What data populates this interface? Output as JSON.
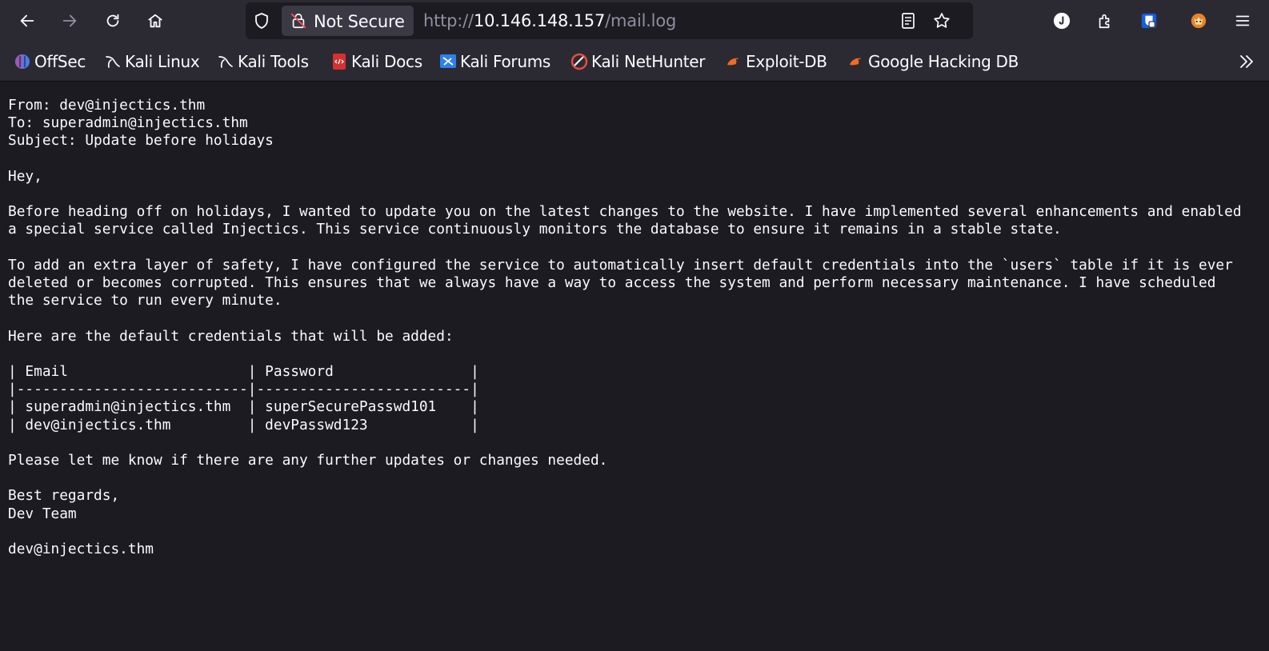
{
  "browser": {
    "security_label": "Not Secure",
    "url_scheme": "http://",
    "url_host": "10.146.148.157",
    "url_path": "/mail.log",
    "icons": [
      "back-icon",
      "forward-icon",
      "reload-icon",
      "home-icon",
      "shield-icon",
      "broken-lock-icon",
      "reader-view-icon",
      "bookmark-star-icon",
      "account-icon",
      "extensions-icon",
      "bitwarden-icon",
      "foxyproxy-icon",
      "menu-icon"
    ]
  },
  "bookmarks": [
    {
      "label": "OffSec",
      "icon": "offsec-icon"
    },
    {
      "label": "Kali Linux",
      "icon": "kali-dragon-icon"
    },
    {
      "label": "Kali Tools",
      "icon": "kali-dragon-icon"
    },
    {
      "label": "Kali Docs",
      "icon": "kali-docs-icon"
    },
    {
      "label": "Kali Forums",
      "icon": "kali-forums-icon"
    },
    {
      "label": "Kali NetHunter",
      "icon": "nethunter-icon"
    },
    {
      "label": "Exploit-DB",
      "icon": "exploitdb-icon"
    },
    {
      "label": "Google Hacking DB",
      "icon": "exploitdb-icon"
    }
  ],
  "colors": {
    "toolbar_bg": "#2b2a33",
    "content_bg": "#1c1b22",
    "text": "#fbfbfe"
  },
  "mail": {
    "from": "From: dev@injectics.thm",
    "to": "To: superadmin@injectics.thm",
    "subject": "Subject: Update before holidays",
    "greeting": "Hey,",
    "para1_line1": "Before heading off on holidays, I wanted to update you on the latest changes to the website. I have implemented several enhancements and enabled",
    "para1_line2": "a special service called Injectics. This service continuously monitors the database to ensure it remains in a stable state.",
    "para2_line1": "To add an extra layer of safety, I have configured the service to automatically insert default credentials into the `users` table if it is ever",
    "para2_line2": "deleted or becomes corrupted. This ensures that we always have a way to access the system and perform necessary maintenance. I have scheduled",
    "para2_line3": "the service to run every minute.",
    "creds_intro": "Here are the default credentials that will be added:",
    "table_header": "| Email                     | Password                |",
    "table_separator": "|---------------------------|-------------------------|",
    "table_row1": "| superadmin@injectics.thm  | superSecurePasswd101    |",
    "table_row2": "| dev@injectics.thm         | devPasswd123            |",
    "closing": "Please let me know if there are any further updates or changes needed.",
    "signoff": "Best regards,",
    "team": "Dev Team",
    "signature": "dev@injectics.thm"
  }
}
